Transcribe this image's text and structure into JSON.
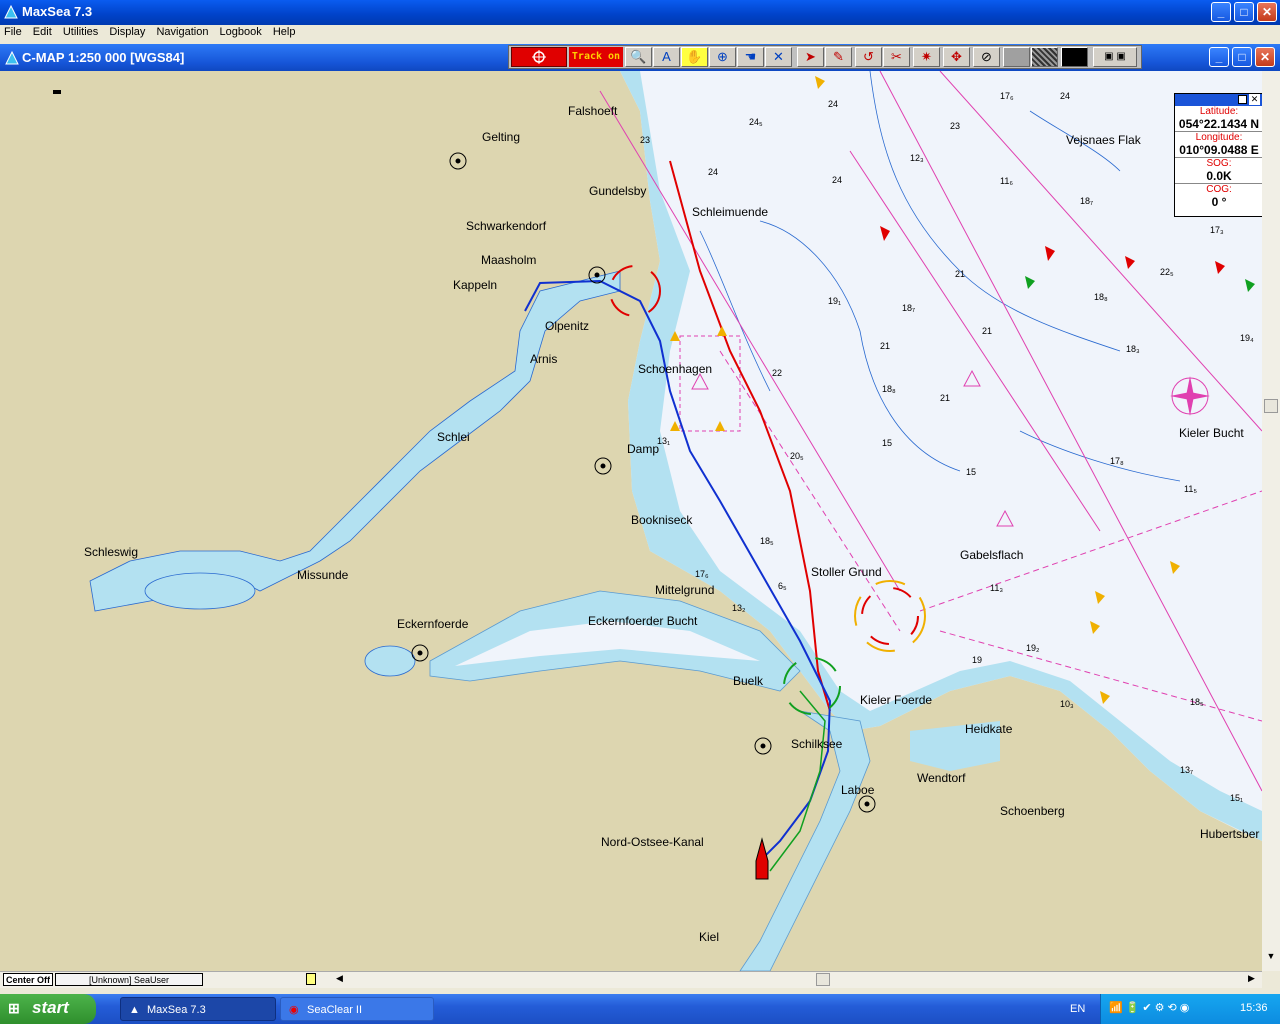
{
  "app": {
    "title": "MaxSea 7.3"
  },
  "menu": [
    "File",
    "Edit",
    "Utilities",
    "Display",
    "Navigation",
    "Logbook",
    "Help"
  ],
  "chart_window": {
    "title": "C-MAP  1:250 000 [WGS84]"
  },
  "toolbar": {
    "track_label": "Track on"
  },
  "info_panel": {
    "latitude_label": "Latitude:",
    "latitude": "054°22.1434 N",
    "longitude_label": "Longitude:",
    "longitude": "010°09.0488 E",
    "sog_label": "SOG:",
    "sog": "0.0K",
    "cog_label": "COG:",
    "cog": "0 °"
  },
  "map_labels": [
    {
      "id": "falshoeft",
      "text": "Falshoeft"
    },
    {
      "id": "gelting",
      "text": "Gelting"
    },
    {
      "id": "gundelsby",
      "text": "Gundelsby"
    },
    {
      "id": "schleimuende",
      "text": "Schleimuende"
    },
    {
      "id": "schwarkendorf",
      "text": "Schwarkendorf"
    },
    {
      "id": "maasholm",
      "text": "Maasholm"
    },
    {
      "id": "kappeln",
      "text": "Kappeln"
    },
    {
      "id": "olpenitz",
      "text": "Olpenitz"
    },
    {
      "id": "arnis",
      "text": "Arnis"
    },
    {
      "id": "schoenhagen",
      "text": "Schoenhagen"
    },
    {
      "id": "schlei",
      "text": "Schlei"
    },
    {
      "id": "damp",
      "text": "Damp"
    },
    {
      "id": "bookniseck",
      "text": "Bookniseck"
    },
    {
      "id": "schleswig",
      "text": "Schleswig"
    },
    {
      "id": "missunde",
      "text": "Missunde"
    },
    {
      "id": "mittelgrund",
      "text": "Mittelgrund"
    },
    {
      "id": "eckernfoerde",
      "text": "Eckernfoerde"
    },
    {
      "id": "eckernfoerder_bucht",
      "text": "Eckernfoerder Bucht"
    },
    {
      "id": "stoller_grund",
      "text": "Stoller Grund"
    },
    {
      "id": "gabelsflach",
      "text": "Gabelsflach"
    },
    {
      "id": "vejsnaes_flak",
      "text": "Vejsnaes Flak"
    },
    {
      "id": "kieler_bucht",
      "text": "Kieler Bucht"
    },
    {
      "id": "buelk",
      "text": "Buelk"
    },
    {
      "id": "kieler_foerde",
      "text": "Kieler Foerde"
    },
    {
      "id": "heidkate",
      "text": "Heidkate"
    },
    {
      "id": "schilksee",
      "text": "Schilksee"
    },
    {
      "id": "laboe",
      "text": "Laboe"
    },
    {
      "id": "wendtorf",
      "text": "Wendtorf"
    },
    {
      "id": "schoenberg",
      "text": "Schoenberg"
    },
    {
      "id": "hubertsber",
      "text": "Hubertsber"
    },
    {
      "id": "nord_ostsee_kanal",
      "text": "Nord-Ostsee-Kanal"
    },
    {
      "id": "kiel",
      "text": "Kiel"
    }
  ],
  "status_bar": {
    "center_label": "Center Off",
    "user_label": "[Unknown] SeaUser"
  },
  "taskbar": {
    "start_label": "start",
    "tasks": [
      "MaxSea 7.3",
      "SeaClear II"
    ],
    "language": "EN",
    "clock": "15:36"
  },
  "colors": {
    "land": "#ddd6b0",
    "shallow": "#b3e1f1",
    "deep": "#f0f4fb",
    "route_red": "#e00000",
    "route_blue": "#1030d0",
    "route_green": "#10a020",
    "titlebar": "#0a5cf0"
  }
}
